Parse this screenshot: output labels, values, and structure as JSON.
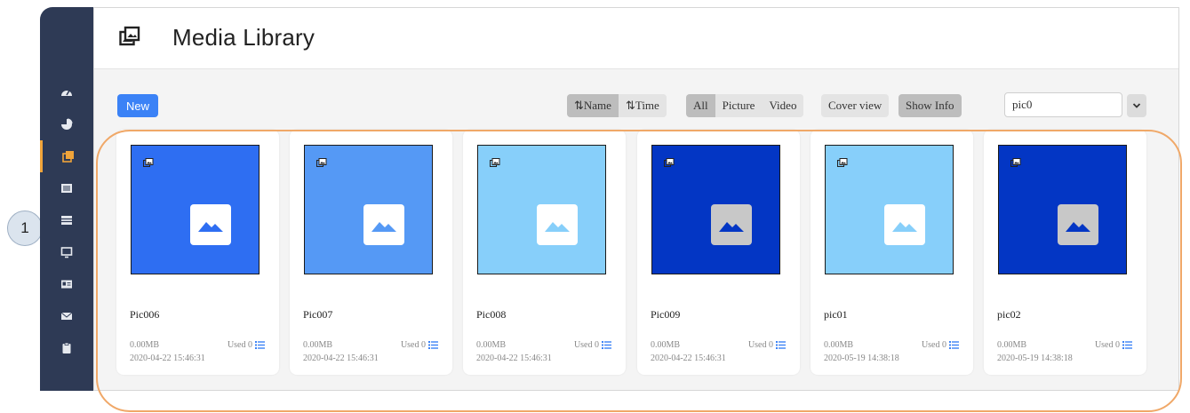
{
  "callout": {
    "number": "1"
  },
  "sidebar": {
    "items": [
      {
        "icon": "dashboard-icon"
      },
      {
        "icon": "pie-chart-icon"
      },
      {
        "icon": "media-library-icon",
        "active": true
      },
      {
        "icon": "list-icon"
      },
      {
        "icon": "table-icon"
      },
      {
        "icon": "monitor-icon"
      },
      {
        "icon": "id-card-icon"
      },
      {
        "icon": "mail-icon"
      },
      {
        "icon": "clipboard-icon"
      }
    ],
    "active_color": "#f0a43a"
  },
  "header": {
    "title": "Media Library"
  },
  "toolbar": {
    "new_label": "New",
    "sort": {
      "name_label": "⇅Name",
      "time_label": "⇅Time",
      "selected": "name"
    },
    "filter": {
      "all_label": "All",
      "picture_label": "Picture",
      "video_label": "Video",
      "selected": "all"
    },
    "cover_view_label": "Cover view",
    "show_info_label": "Show Info",
    "search_value": "pic0"
  },
  "cards": [
    {
      "name": "Pic006",
      "size": "0.00MB",
      "used": "Used 0",
      "date": "2020-04-22 15:46:31",
      "color": "#2e6ef2",
      "badge": "#ffffff",
      "mtn": "#2e6ef2"
    },
    {
      "name": "Pic007",
      "size": "0.00MB",
      "used": "Used 0",
      "date": "2020-04-22 15:46:31",
      "color": "#5599f5",
      "badge": "#ffffff",
      "mtn": "#5599f5"
    },
    {
      "name": "Pic008",
      "size": "0.00MB",
      "used": "Used 0",
      "date": "2020-04-22 15:46:31",
      "color": "#87cffa",
      "badge": "#ffffff",
      "mtn": "#87cffa"
    },
    {
      "name": "Pic009",
      "size": "0.00MB",
      "used": "Used 0",
      "date": "2020-04-22 15:46:31",
      "color": "#0336c4",
      "badge": "#c8c8c8",
      "mtn": "#0336c4"
    },
    {
      "name": "pic01",
      "size": "0.00MB",
      "used": "Used 0",
      "date": "2020-05-19 14:38:18",
      "color": "#87cffa",
      "badge": "#ffffff",
      "mtn": "#87cffa"
    },
    {
      "name": "pic02",
      "size": "0.00MB",
      "used": "Used 0",
      "date": "2020-05-19 14:38:18",
      "color": "#0336c4",
      "badge": "#c8c8c8",
      "mtn": "#0336c4"
    }
  ],
  "accent_colors": {
    "primary": "#3b82f6",
    "highlight_outline": "#f0a868",
    "sidebar_bg": "#2e3a55"
  }
}
